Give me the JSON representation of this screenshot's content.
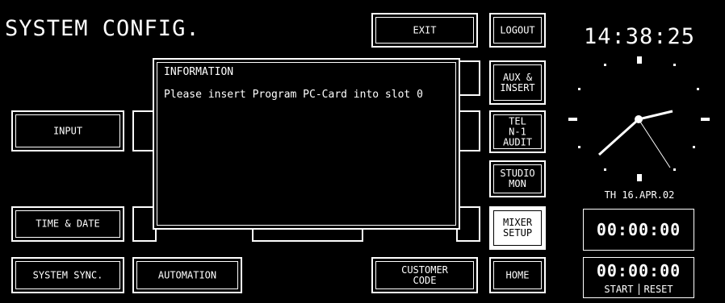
{
  "screen": {
    "title": "SYSTEM CONFIG.",
    "buttons": {
      "exit": "EXIT",
      "input": "INPUT",
      "time_date": "TIME & DATE",
      "system_sync": "SYSTEM SYNC.",
      "automation": "AUTOMATION",
      "customer_code": "CUSTOMER\nCODE"
    },
    "side": {
      "logout": "LOGOUT",
      "aux_insert": "AUX &\nINSERT",
      "tel_n1_audit": "TEL\nN-1\nAUDIT",
      "studio_mon": "STUDIO\nMON",
      "mixer_setup": "MIXER\nSETUP",
      "home": "HOME"
    }
  },
  "clock": {
    "time": "14:38:25",
    "date": "TH 16.APR.02"
  },
  "timers": {
    "timer1": "00:00:00",
    "timer2": "00:00:00",
    "start": "START",
    "reset": "RESET"
  },
  "dialog": {
    "header": "INFORMATION",
    "message": "Please insert Program PC-Card into slot 0"
  },
  "colors": {
    "background": "#000000",
    "foreground": "#ffffff"
  }
}
